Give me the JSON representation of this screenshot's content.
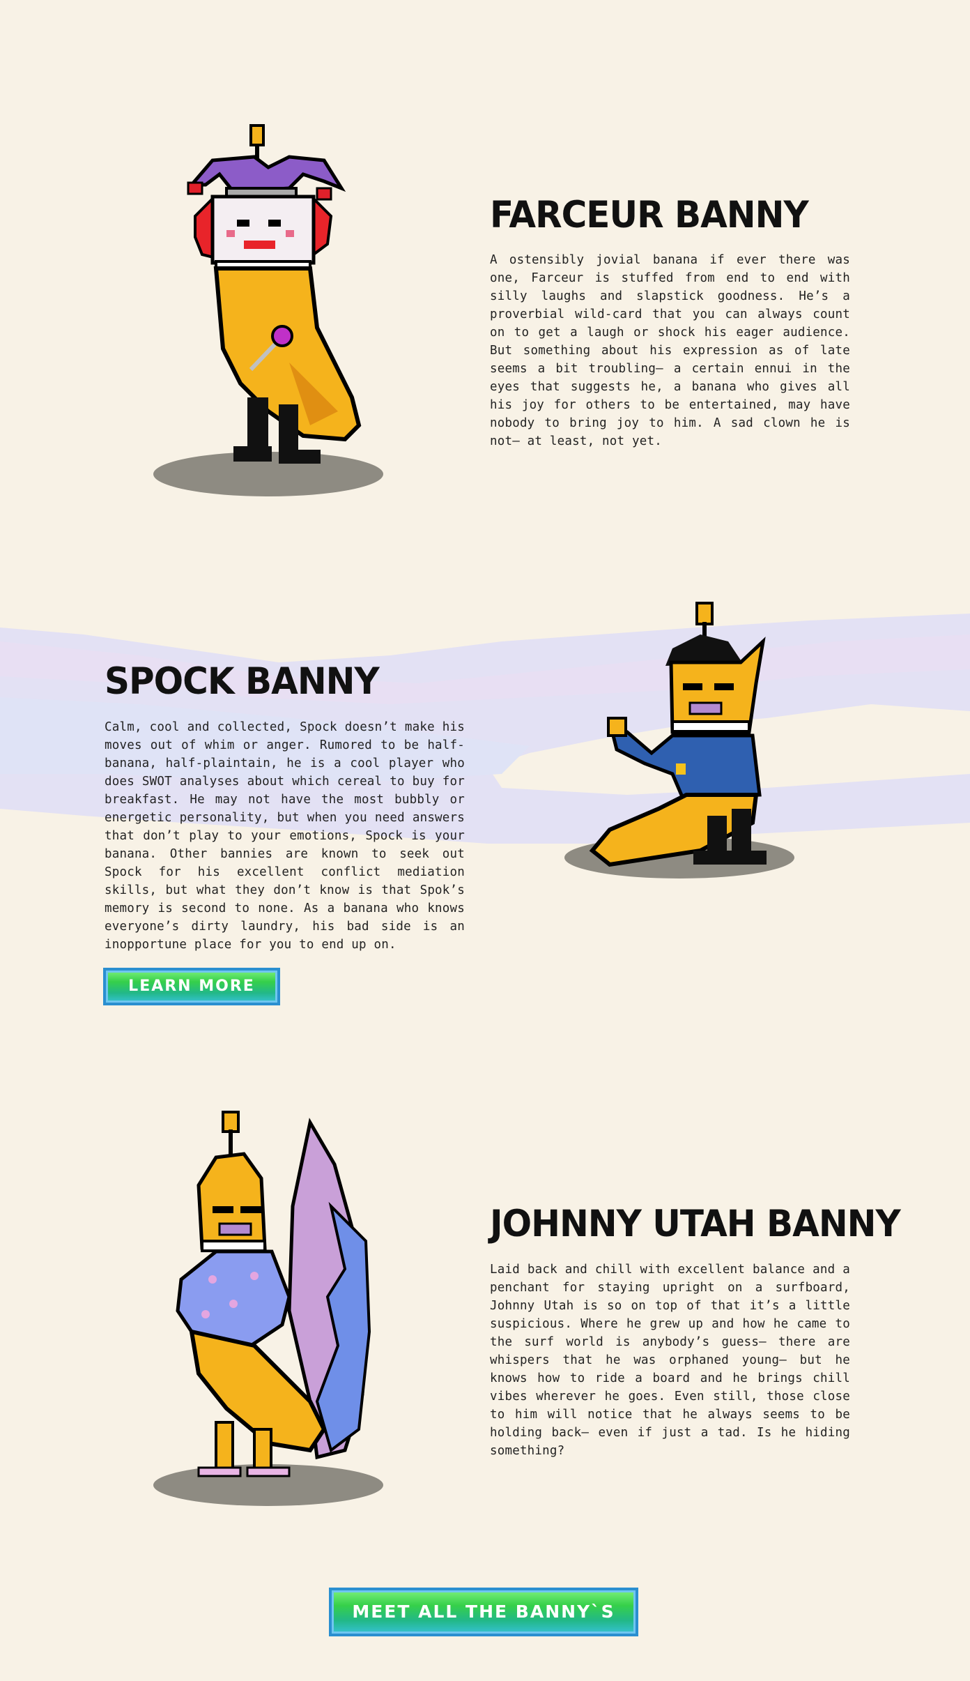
{
  "characters": [
    {
      "name": "FARCEUR BANNY",
      "description": "A ostensibly jovial banana if ever there was one, Farceur is stuffed from end to end with silly laughs and slapstick goodness. He’s a proverbial wild-card that you can always count on to get a laugh or shock his eager audience. But something about his expression as of late seems a bit troubling— a certain ennui in the eyes that suggests he, a banana who gives all his joy for others to be entertained, may have nobody to bring joy to him. A sad clown he is not— at least, not yet."
    },
    {
      "name": "SPOCK BANNY",
      "description": "Calm, cool and collected, Spock doesn’t make his moves out of whim or anger. Rumored to be half-banana, half-plaintain, he is a cool player who does SWOT analyses about which cereal to buy for breakfast. He may not have the most bubbly or energetic personality, but when you need answers that don’t play to your emotions, Spock is your banana. Other bannies are known to seek out Spock for his excellent conflict mediation skills, but what they don’t know is that Spok’s memory is second to none. As a banana who knows everyone’s dirty laundry, his bad side is an inopportune place for you to end up on.",
      "button": "LEARN MORE"
    },
    {
      "name": "JOHNNY UTAH BANNY",
      "description": "Laid back and chill with excellent balance and a penchant for staying upright on a surfboard, Johnny Utah is so on top of that it’s a little suspicious. Where he grew up and how he came to the surf world is anybody’s guess— there are whispers that he was orphaned young— but he knows how to ride a board and he brings chill vibes wherever he goes. Even still, those close to him will notice that he always seems to be holding back— even if just a tad. Is he hiding something?"
    }
  ],
  "footer": {
    "button": "MEET ALL THE BANNY`S"
  },
  "colors": {
    "background": "#f8f2e6",
    "banana": "#f5b31c",
    "shadow": "#8e8b82",
    "button_border": "#2a8fd0"
  }
}
